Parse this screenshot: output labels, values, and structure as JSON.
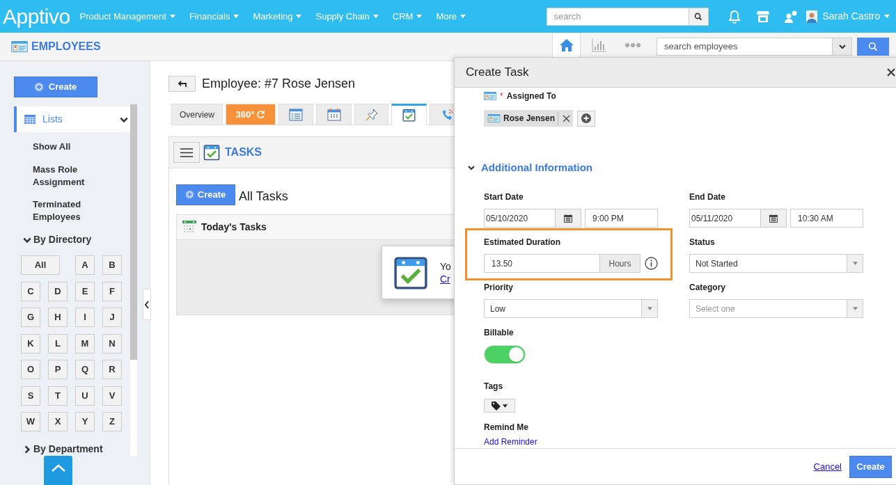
{
  "top_nav": {
    "logo": "Apptivo",
    "menus": [
      {
        "label": "Product Management"
      },
      {
        "label": "Financials"
      },
      {
        "label": "Marketing"
      },
      {
        "label": "Supply Chain"
      },
      {
        "label": "CRM"
      },
      {
        "label": "More"
      }
    ],
    "search": {
      "placeholder": "search"
    },
    "user": "Sarah Castro"
  },
  "app_bar": {
    "title": "EMPLOYEES",
    "views": [
      {
        "kind": "home",
        "selected": true
      },
      {
        "kind": "chart",
        "selected": false
      },
      {
        "kind": "more",
        "selected": false
      }
    ],
    "search": {
      "placeholder": "search employees"
    }
  },
  "sidebar": {
    "create_button": "Create",
    "lists": {
      "label": "Lists",
      "expanded": true
    },
    "items": [
      "Show All",
      "Mass Role Assignment",
      "Terminated Employees"
    ],
    "by_directory": {
      "label": "By Directory",
      "expanded": true,
      "letters": [
        "All",
        "A",
        "B",
        "C",
        "D",
        "E",
        "F",
        "G",
        "H",
        "I",
        "J",
        "K",
        "L",
        "M",
        "N",
        "O",
        "P",
        "Q",
        "R",
        "S",
        "T",
        "U",
        "V",
        "W",
        "X",
        "Y",
        "Z"
      ]
    },
    "by_department": {
      "label": "By Department",
      "expanded": false
    }
  },
  "record": {
    "title": "Employee: #7 Rose Jensen",
    "tabs": [
      {
        "kind": "text",
        "label": "Overview",
        "selected": false
      },
      {
        "kind": "rotation",
        "label": "360°",
        "selected": false
      },
      {
        "kind": "form",
        "selected": false
      },
      {
        "kind": "calendar",
        "selected": false
      },
      {
        "kind": "pin",
        "selected": false
      },
      {
        "kind": "tasks",
        "selected": true
      },
      {
        "kind": "phone",
        "selected": false
      }
    ]
  },
  "tasks": {
    "title": "TASKS",
    "create_button": "Create",
    "heading": "All Tasks",
    "today": {
      "title": "Today's Tasks"
    },
    "popup": {
      "text": "Yo",
      "link": "Cr"
    }
  },
  "create_task": {
    "title": "Create Task",
    "assigned_to": {
      "required_mark": "*",
      "label": "Assigned To",
      "assignees": [
        "Rose Jensen"
      ]
    },
    "section": {
      "label": "Additional Information",
      "expanded": true
    },
    "start_date": {
      "label": "Start Date",
      "date": "05/10/2020",
      "time": "9:00 PM"
    },
    "end_date": {
      "label": "End Date",
      "date": "05/11/2020",
      "time": "10:30 AM"
    },
    "estimated_duration": {
      "label": "Estimated Duration",
      "value": "13.50",
      "unit": "Hours",
      "highlighted": true
    },
    "status": {
      "label": "Status",
      "value": "Not Started"
    },
    "priority": {
      "label": "Priority",
      "value": "Low"
    },
    "category": {
      "label": "Category",
      "placeholder": "Select one"
    },
    "billable": {
      "label": "Billable",
      "on": true
    },
    "tags": {
      "label": "Tags"
    },
    "remind_me": {
      "label": "Remind Me",
      "link": "Add Reminder"
    },
    "cancel": "Cancel",
    "create": "Create"
  }
}
